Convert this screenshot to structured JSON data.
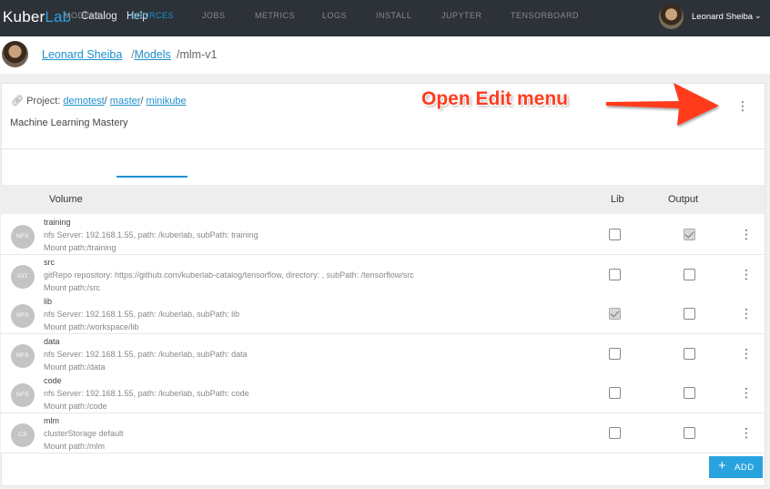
{
  "header": {
    "logo_part1": "Kuber",
    "logo_part2": "Lab",
    "nav": [
      "Catalog",
      "Help"
    ],
    "user_name": "Leonard Sheiba",
    "user_caret": "⌄"
  },
  "breadcrumb": {
    "owner": "Leonard Sheiba",
    "sep1": "/",
    "section": "Models",
    "sep2": "/",
    "current": "mlm-v1"
  },
  "project": {
    "label": "Project:",
    "workspace": "demotest",
    "branch": "master",
    "cluster": "minikube",
    "description": "Machine Learning Mastery"
  },
  "annotation": {
    "text": "Open Edit menu",
    "color": "#ff3b1f"
  },
  "tabs": [
    {
      "label": "MODELS",
      "active": false
    },
    {
      "label": "SOURCES",
      "active": true
    },
    {
      "label": "JOBS",
      "active": false
    },
    {
      "label": "METRICS",
      "active": false
    },
    {
      "label": "LOGS",
      "active": false
    },
    {
      "label": "INSTALL",
      "active": false
    },
    {
      "label": "JUPYTER",
      "active": false
    },
    {
      "label": "TENSORBOARD",
      "active": false
    }
  ],
  "table": {
    "columns": [
      "Volume",
      "Lib",
      "Output"
    ],
    "rows": [
      {
        "badge": "NFS",
        "name": "training",
        "info": "nfs Server: 192.168.1.55, path: /kuberlab, subPath: training",
        "mount": "Mount path:/training",
        "lib": false,
        "output": true
      },
      {
        "badge": "GIT",
        "name": "src",
        "info": "gitRepo repository: https://github.com/kuberlab-catalog/tensorflow, directory: , subPath: /tensorflow/src",
        "mount": "Mount path:/src",
        "lib": false,
        "output": false
      },
      {
        "badge": "NFS",
        "name": "lib",
        "info": "nfs Server: 192.168.1.55, path: /kuberlab, subPath: lib",
        "mount": "Mount path:/workspace/lib",
        "lib": true,
        "output": false
      },
      {
        "badge": "NFS",
        "name": "data",
        "info": "nfs Server: 192.168.1.55, path: /kuberlab, subPath: data",
        "mount": "Mount path:/data",
        "lib": false,
        "output": false
      },
      {
        "badge": "NFS",
        "name": "code",
        "info": "nfs Server: 192.168.1.55, path: /kuberlab, subPath: code",
        "mount": "Mount path:/code",
        "lib": false,
        "output": false
      },
      {
        "badge": "CS",
        "name": "mlm",
        "info": "clusterStorage default",
        "mount": "Mount path:/mlm",
        "lib": false,
        "output": false
      }
    ]
  },
  "add_button": {
    "icon": "+",
    "label": "ADD"
  },
  "colors": {
    "accent": "#1d8fd0",
    "topbar": "#2c3238",
    "add_button": "#29a3df"
  }
}
